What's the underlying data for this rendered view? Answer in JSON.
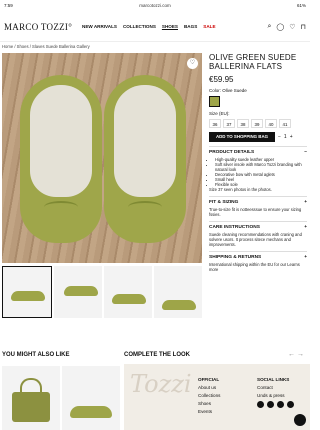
{
  "status": {
    "time": "7:59",
    "date": "Mon 21.2 apr.",
    "url": "marcotozzi.com",
    "battery": "61%"
  },
  "header": {
    "logo": "MARCO TOZZI°",
    "nav": [
      "NEW ARRIVALS",
      "COLLECTIONS",
      "SHOES",
      "BAGS",
      "SALE"
    ],
    "icons": [
      "search-icon",
      "user-icon",
      "heart-icon",
      "bag-icon"
    ]
  },
  "breadcrumb": "Home / Shoes / Slaves Suede Ballerina Gallery",
  "product": {
    "title": "OLIVE GREEN SUEDE BALLERINA FLATS",
    "price": "€59.95",
    "color_label": "Color: Olive Suede",
    "size_label": "Size (EU):",
    "sizes": [
      "36",
      "37",
      "38",
      "39",
      "40",
      "41"
    ],
    "add_to_bag": "ADD TO SHOPPING BAG",
    "qty": "1",
    "sections": [
      {
        "title": "PRODUCT DETAILS",
        "lines": [
          "High-quality suede leather upper",
          "Soft silver insole with Marco Tozzi branding with natural look",
          "Decorative bow with metal aglets",
          "Small heel",
          "Flexible sole"
        ],
        "extra": "Size 37 seen photos in the photos."
      },
      {
        "title": "FIT & SIZING",
        "text": "True-to-size fit is notteesssue to ensure your sizing fssies."
      },
      {
        "title": "CARE INSTRUCTIONS",
        "text": "Suede cleaning recommendations with craning and solvere usors. It process sitece mechans and improvements."
      },
      {
        "title": "SHIPPING & RETURNS",
        "text": "International shipping within the EU for our Learns more"
      }
    ]
  },
  "recommend": {
    "also": "YOU MIGHT ALSO LIKE",
    "look": "COMPLETE THE LOOK"
  },
  "footer": {
    "official_title": "OFFICIAL",
    "official": [
      "About us",
      "Collections",
      "Shoes",
      "Events"
    ],
    "social_title": "SOCIAL LINKS",
    "social": [
      "Contact",
      "Unds & press"
    ]
  },
  "colors": {
    "olive": "#9ea548",
    "accent": "#111111",
    "sale": "#cc0000"
  }
}
